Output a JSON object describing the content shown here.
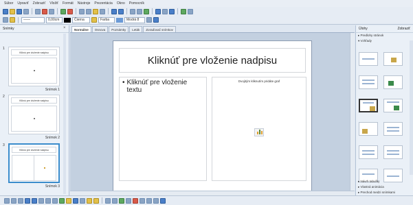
{
  "menubar": [
    "Súbor",
    "Upraviť",
    "Zobraziť",
    "Vložiť",
    "Formát",
    "Nástroje",
    "Prezentácia",
    "Okno",
    "Pomocník"
  ],
  "toolbar2": {
    "line_width": "0,00cm",
    "line_color": "Čierna",
    "fill_type": "Farba",
    "fill_color": "Modrá 8"
  },
  "slides_pane": {
    "title": "Snímky",
    "slides": [
      {
        "number": "1",
        "label": "Snímok 1",
        "thumb_title": "Kliknú pre vloženie nadpisu",
        "layout": "title"
      },
      {
        "number": "2",
        "label": "Snímok 2",
        "thumb_title": "Kliknú pre vloženie nadpisu",
        "layout": "title"
      },
      {
        "number": "3",
        "label": "Snímok 3",
        "thumb_title": "Kliknú pre vloženie nadpisu",
        "layout": "two-col"
      }
    ]
  },
  "view_tabs": [
    "Normálne",
    "Osnova",
    "Poznámky",
    "Leták",
    "Zoraďovač snímkov"
  ],
  "slide": {
    "title_placeholder": "Kliknúť pre vloženie nadpisu",
    "text_placeholder": "Kliknúť pre vloženie textu",
    "chart_placeholder": "Dvojitým kliknutím pridáte graf"
  },
  "tasks_pane": {
    "title": "Úlohy",
    "view_label": "Zobraziť",
    "sections_top": [
      "Predlohy stránok",
      "Vzhľady"
    ],
    "sections_bottom": [
      "Návrh tabuľky",
      "Vlastná animácia",
      "Prechod medzi snímkami"
    ]
  },
  "colors": {
    "accent": "#3a8ccc",
    "background": "#dfe7f1"
  }
}
